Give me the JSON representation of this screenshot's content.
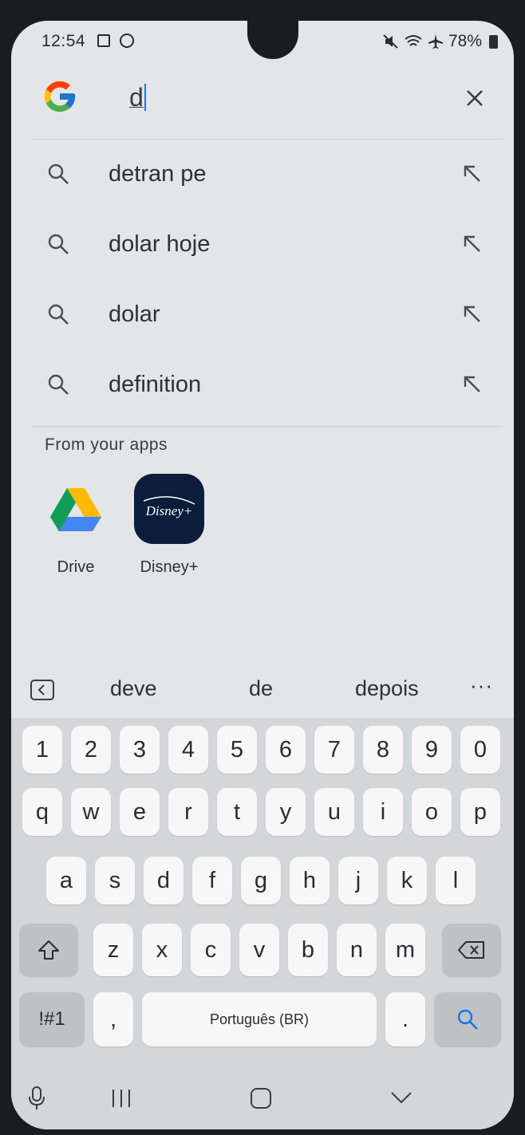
{
  "status_bar": {
    "time": "12:54",
    "battery": "78%"
  },
  "search": {
    "query": "d",
    "clear_label": "×"
  },
  "suggestions": [
    {
      "text": "detran pe"
    },
    {
      "text": "dolar hoje"
    },
    {
      "text": "dolar"
    },
    {
      "text": "definition"
    }
  ],
  "from_apps": {
    "heading": "From your apps",
    "apps": [
      {
        "label": "Drive",
        "icon": "google-drive-icon"
      },
      {
        "label": "Disney+",
        "icon": "disney-plus-icon",
        "logo_text": "Disney+"
      }
    ]
  },
  "keyboard": {
    "suggestions": [
      "deve",
      "de",
      "depois"
    ],
    "more_label": "···",
    "row_numbers": [
      "1",
      "2",
      "3",
      "4",
      "5",
      "6",
      "7",
      "8",
      "9",
      "0"
    ],
    "row_top": [
      "q",
      "w",
      "e",
      "r",
      "t",
      "y",
      "u",
      "i",
      "o",
      "p"
    ],
    "row_middle": [
      "a",
      "s",
      "d",
      "f",
      "g",
      "h",
      "j",
      "k",
      "l"
    ],
    "row_bottom": [
      "z",
      "x",
      "c",
      "v",
      "b",
      "n",
      "m"
    ],
    "symbols_label": "!#1",
    "comma_label": ",",
    "space_label": "Português (BR)",
    "period_label": "."
  },
  "colors": {
    "accent": "#1a73e8",
    "screen_bg": "#e3e5e8",
    "keyboard_bg": "#d4d6d9"
  }
}
